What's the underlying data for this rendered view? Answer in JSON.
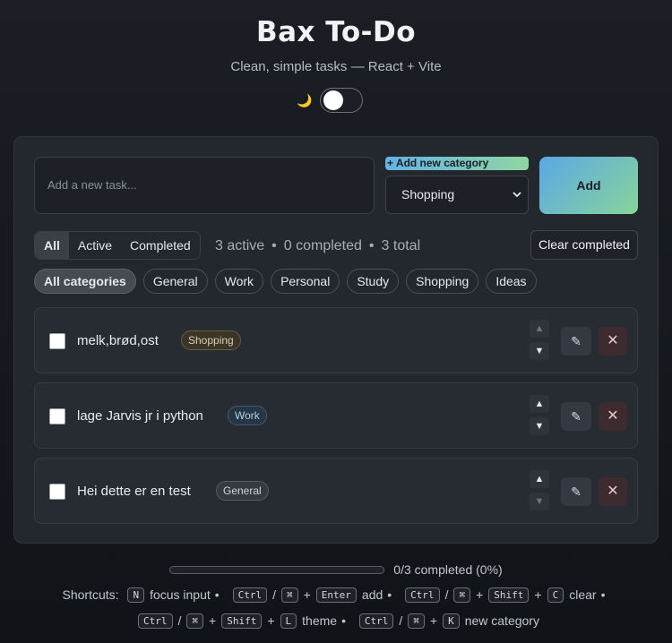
{
  "header": {
    "title": "Bax To-Do",
    "subtitle": "Clean, simple tasks — React + Vite",
    "theme_icon": "moon-icon"
  },
  "composer": {
    "input_placeholder": "Add a new task...",
    "add_category_label": "+ Add new category",
    "category_selected": "Shopping",
    "add_button": "Add"
  },
  "filters": {
    "tabs": [
      "All",
      "Active",
      "Completed"
    ],
    "active_tab": "All",
    "active_count": "3 active",
    "completed_count": "0 completed",
    "total_count": "3 total",
    "clear_button": "Clear completed"
  },
  "categories": [
    "All categories",
    "General",
    "Work",
    "Personal",
    "Study",
    "Shopping",
    "Ideas"
  ],
  "tasks": [
    {
      "text": "melk,brød,ost",
      "tag": "Shopping"
    },
    {
      "text": "lage Jarvis jr i python",
      "tag": "Work"
    },
    {
      "text": "Hei dette er en test",
      "tag": "General"
    }
  ],
  "progress": {
    "label": "0/3 completed (0%)",
    "fraction": 0
  },
  "shortcuts": {
    "label": "Shortcuts:",
    "key_n": "N",
    "focus_input": "focus input",
    "ctrl": "Ctrl",
    "cmd": "⌘",
    "enter": "Enter",
    "add": "add",
    "shift": "Shift",
    "key_c": "C",
    "clear": "clear",
    "key_l": "L",
    "theme": "theme",
    "key_k": "K",
    "new_category": "new category"
  }
}
